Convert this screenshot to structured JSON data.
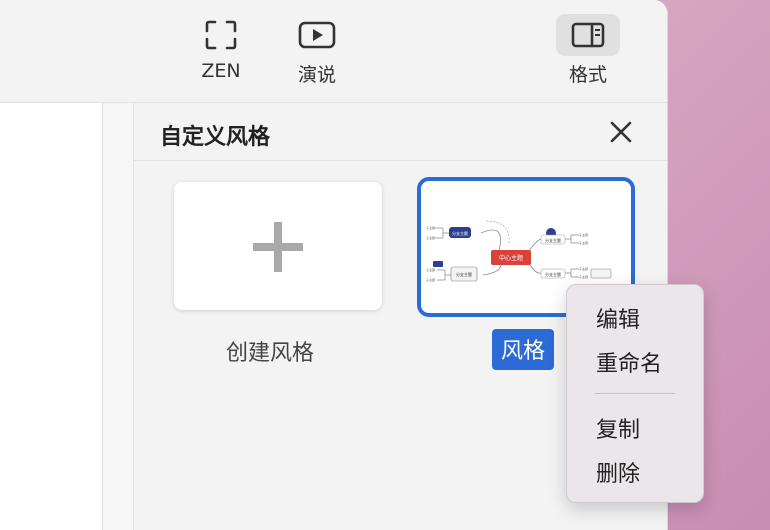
{
  "toolbar": {
    "zen_label": "ZEN",
    "present_label": "演说",
    "format_label": "格式"
  },
  "panel": {
    "title": "自定义风格",
    "create_label": "创建风格",
    "style_label": "风格"
  },
  "thumbnail": {
    "center_topic": "中心主题",
    "main_topic_1": "分支主题",
    "main_topic_2": "分支主题",
    "left_topic_1": "分支主题",
    "left_topic_2": "分支主题",
    "sub": "子主题",
    "accent": "#d9413b",
    "branch_color": "#2f3f8f"
  },
  "context_menu": {
    "edit": "编辑",
    "rename": "重命名",
    "copy": "复制",
    "delete": "删除"
  },
  "colors": {
    "selection": "#2c6bd6",
    "background": "#d8a9c4"
  }
}
